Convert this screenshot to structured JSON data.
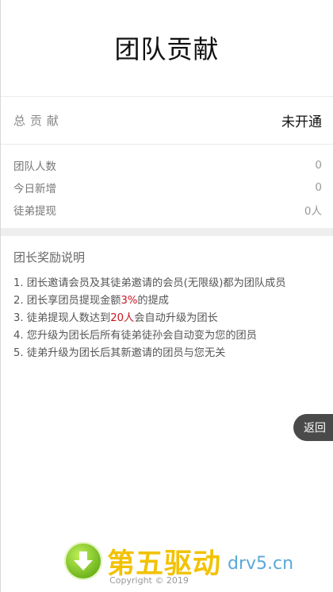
{
  "header": {
    "title": "团队贡献"
  },
  "total": {
    "label": "总贡献",
    "value": "未开通"
  },
  "stats": [
    {
      "label": "团队人数",
      "value": "0"
    },
    {
      "label": "今日新增",
      "value": "0"
    },
    {
      "label": "徒弟提现",
      "value": "0人"
    }
  ],
  "rules": {
    "title": "团长奖励说明",
    "items": [
      {
        "before": "1. 团长邀请会员及其徒弟邀请的会员(无限级)都为团队成员",
        "highlight": "",
        "after": ""
      },
      {
        "before": "2. 团长享团员提现金额",
        "highlight": "3%",
        "after": "的提成"
      },
      {
        "before": "3. 徒弟提现人数达到",
        "highlight": "20人",
        "after": "会自动升级为团长"
      },
      {
        "before": "4. 您升级为团长后所有徒弟徒孙会自动变为您的团员",
        "highlight": "",
        "after": ""
      },
      {
        "before": "5. 徒弟升级为团长后其新邀请的团员与您无关",
        "highlight": "",
        "after": ""
      }
    ]
  },
  "back_button": {
    "label": "返回"
  },
  "footer": {
    "copyright": "Copyright © 2019"
  },
  "watermark": {
    "cn": "第五驱动",
    "en": "drv5.cn"
  },
  "colors": {
    "highlight": "#c8161d",
    "back_button_bg": "#4a4a4a",
    "divider": "#eeeeee"
  }
}
